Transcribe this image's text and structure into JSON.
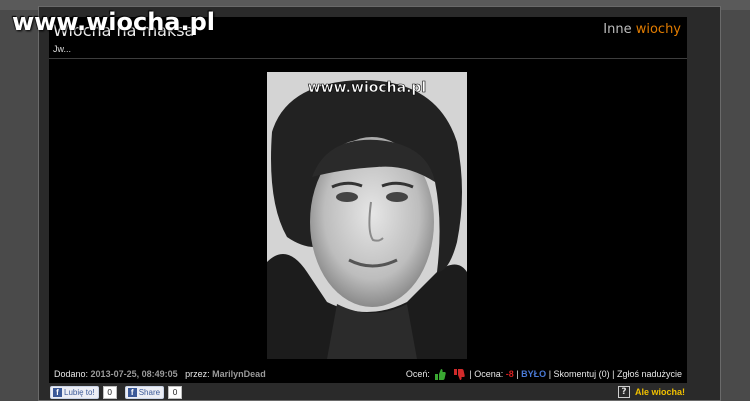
{
  "site": {
    "logo_text": "www.wiocha.pl"
  },
  "post": {
    "title": "Wiocha na maksa",
    "subtitle": "Jw...",
    "photo_watermark": "www.wiocha.pl"
  },
  "header_link": {
    "part1": "Inne",
    "part2": "wiochy"
  },
  "footer": {
    "added_label": "Dodano:",
    "added_value": "2013-07-25, 08:49:05",
    "by_label": "przez:",
    "by_value": "MarilynDead",
    "rate_label": "Oceń:",
    "rating_label": "| Ocena:",
    "rating_value": "-8",
    "bylo": "BYŁO",
    "comment": "Skomentuj (0)",
    "report": "Zgłoś nadużycie",
    "sep": "|"
  },
  "social": {
    "like_label": "Lubię to!",
    "like_count": "0",
    "share_label": "Share",
    "share_count": "0"
  },
  "bottom": {
    "help": "?",
    "ale_wiocha": "Ale wiocha!"
  },
  "colors": {
    "accent": "#e07b00",
    "yellow": "#f0c000",
    "minus": "#d62020",
    "bylo": "#4a7ad6"
  }
}
